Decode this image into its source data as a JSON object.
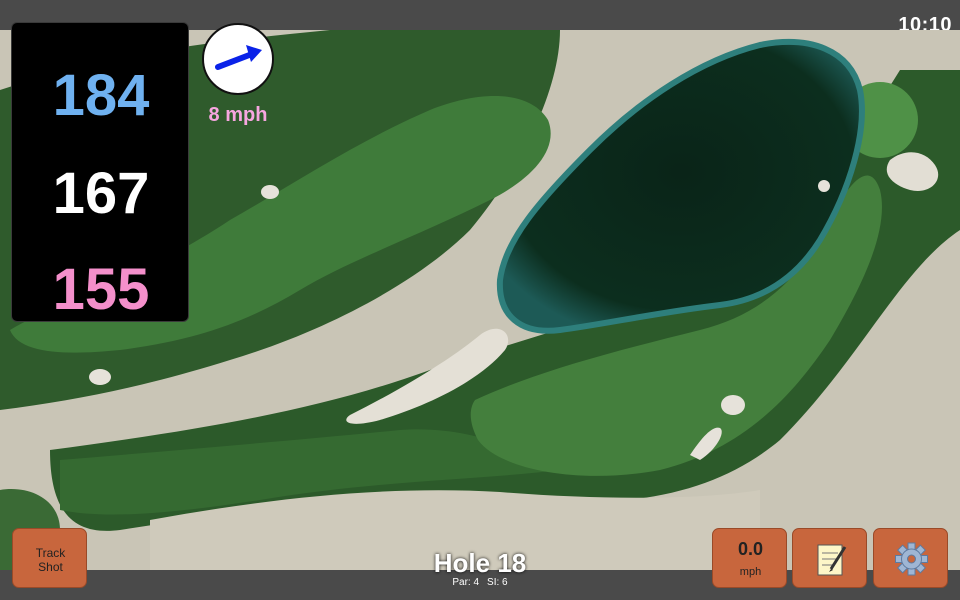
{
  "status": {
    "clock": "10:10"
  },
  "distances": {
    "back": "184",
    "middle": "167",
    "front": "155"
  },
  "wind": {
    "speed_label": "8 mph",
    "icon": "wind-direction-arrow-icon"
  },
  "hole": {
    "title": "Hole 18",
    "par": "Par: 4",
    "si": "SI: 6"
  },
  "buttons": {
    "track_shot": "Track\nShot",
    "speed_value": "0.0",
    "speed_unit": "mph",
    "notes_icon": "notepad-icon",
    "settings_icon": "gear-icon"
  },
  "colors": {
    "back_distance": "#6fb1f0",
    "middle_distance": "#ffffff",
    "front_distance": "#f48fcb",
    "wind_text": "#f7a6e0",
    "button": "#c8663d"
  }
}
